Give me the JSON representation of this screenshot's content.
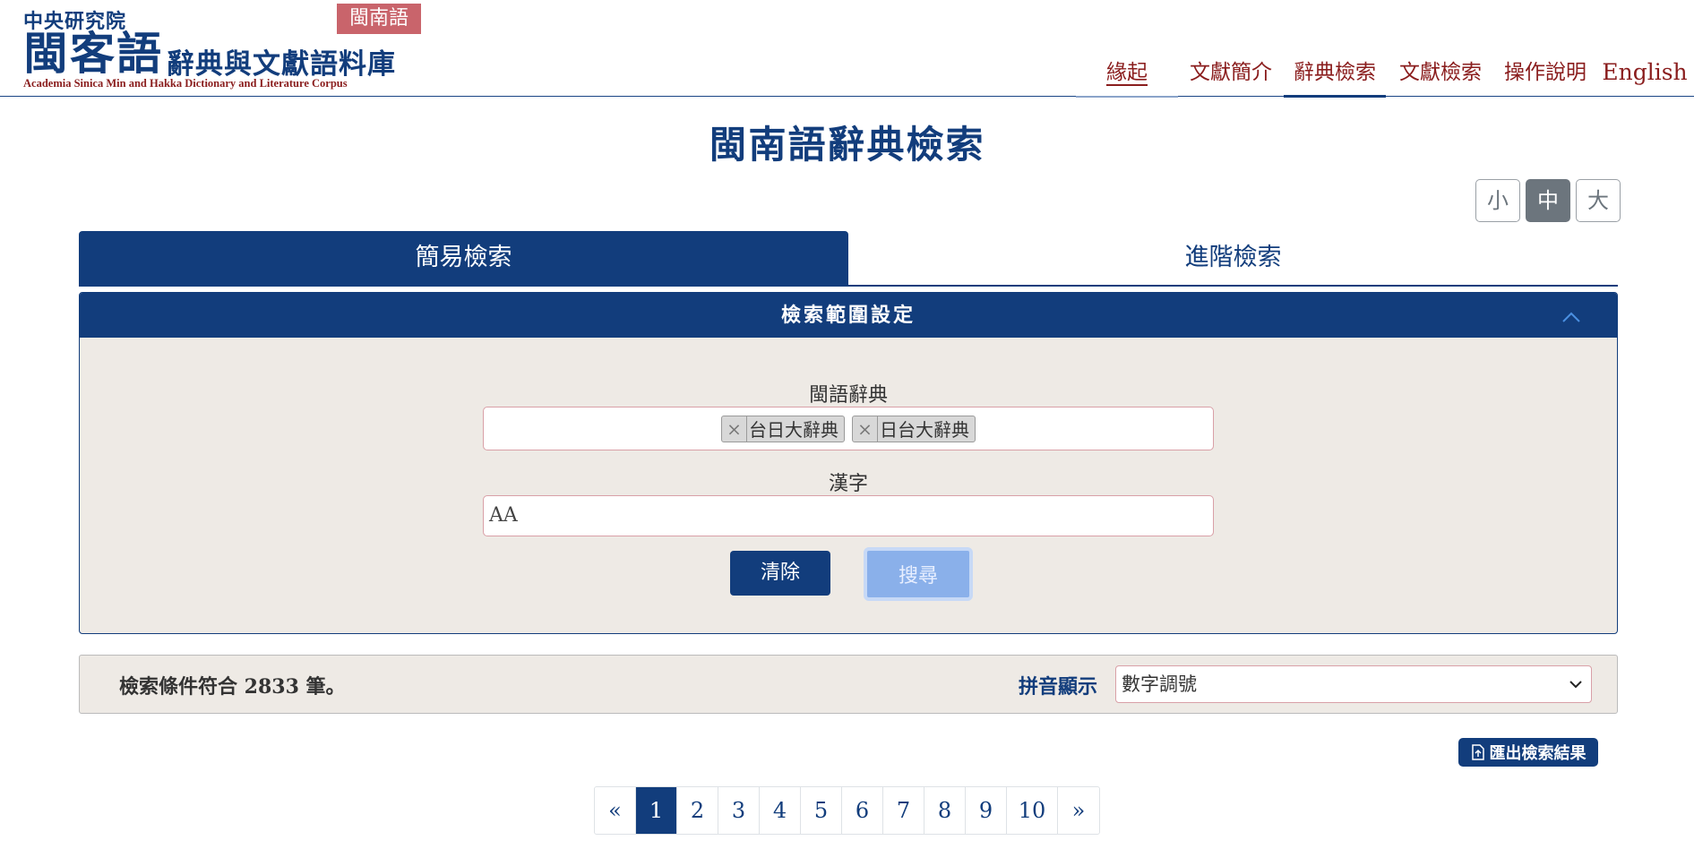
{
  "header": {
    "org": "中央研究院",
    "logo_main": "閩客語",
    "logo_sub": "辭典與文獻語料庫",
    "logo_en": "Academia Sinica Min and Hakka Dictionary and Literature Corpus",
    "lang_badge": "閩南語"
  },
  "nav": {
    "items": [
      "緣起",
      "文獻簡介",
      "辭典檢索",
      "文獻檢索",
      "操作說明",
      "English"
    ]
  },
  "page_title": "閩南語辭典檢索",
  "font_size": {
    "small": "小",
    "medium": "中",
    "large": "大",
    "selected": "中"
  },
  "tabs": {
    "simple": "簡易檢索",
    "advanced": "進階檢索"
  },
  "range_panel": {
    "title": "檢索範圍設定",
    "dict_label": "閩語辭典",
    "chips": [
      "台日大辭典",
      "日台大辭典"
    ],
    "chip_remove": "×",
    "hanzi_label": "漢字",
    "hanzi_value": "AA",
    "clear_label": "清除",
    "search_label": "搜尋"
  },
  "results": {
    "summary": "檢索條件符合 2833 筆。",
    "pinyin_label": "拼音顯示",
    "pinyin_value": "數字調號"
  },
  "export_label": "匯出檢索結果",
  "pagination": {
    "prev": "«",
    "next": "»",
    "pages": [
      "1",
      "2",
      "3",
      "4",
      "5",
      "6",
      "7",
      "8",
      "9",
      "10"
    ],
    "current": "1"
  },
  "colors": {
    "primary": "#123d7c",
    "accent_red": "#8a1d1d",
    "badge": "#c9646b",
    "panel_bg": "#eeeae5"
  }
}
